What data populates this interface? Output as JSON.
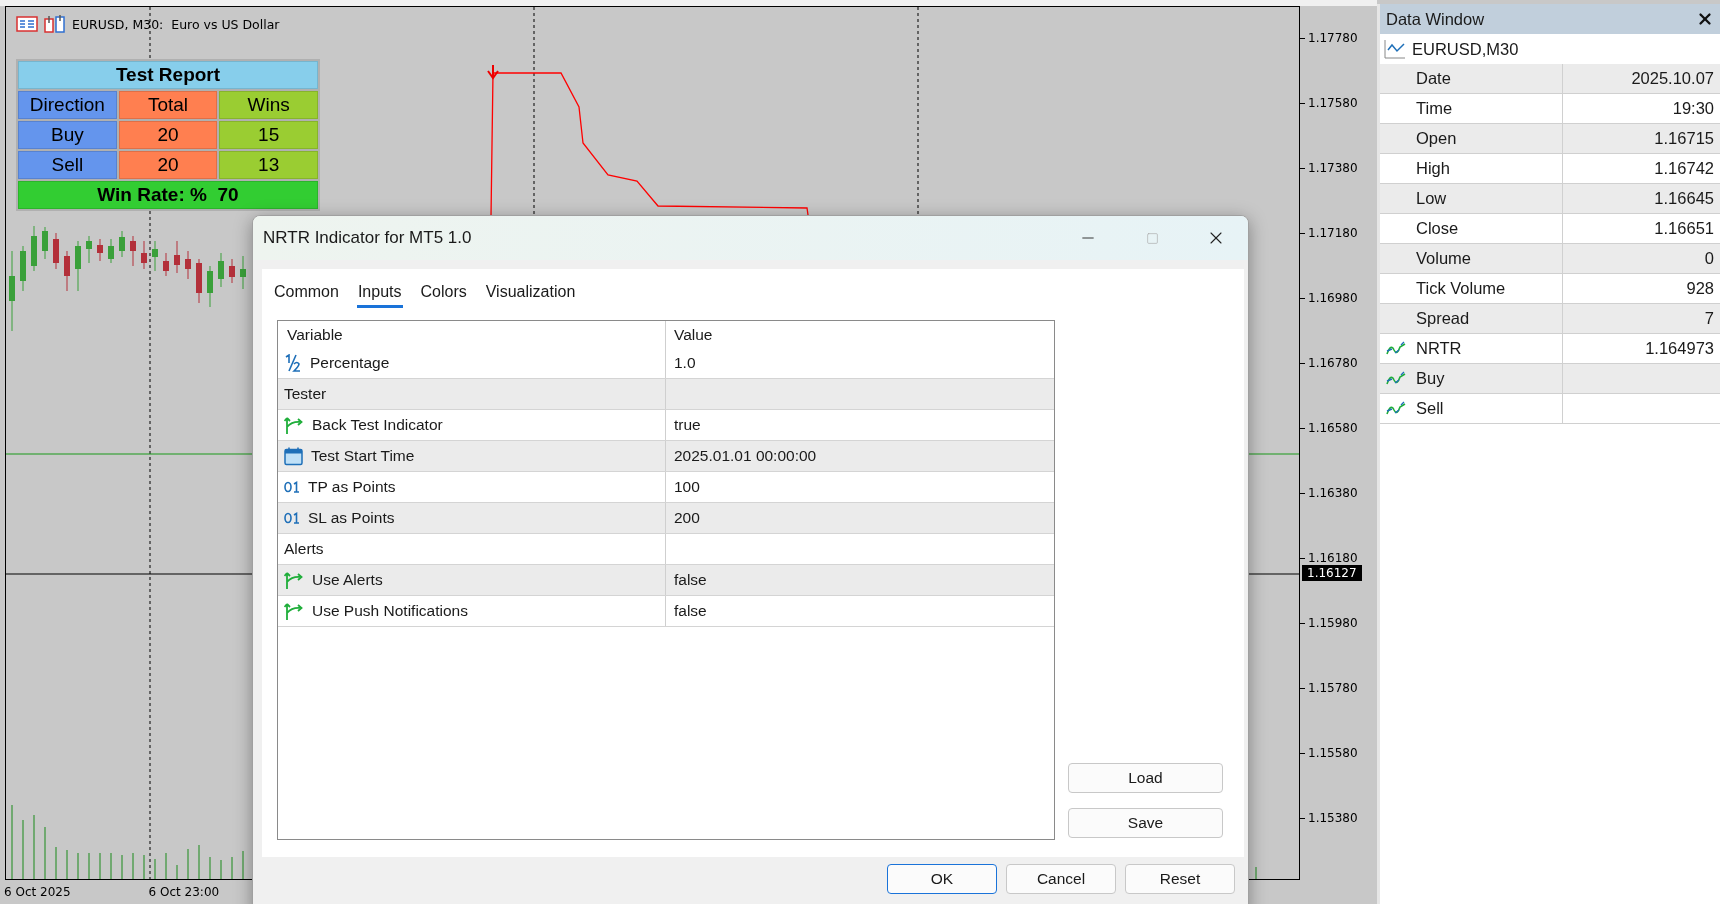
{
  "chart": {
    "title": "EURUSD, M30:  Euro vs US Dollar",
    "report": {
      "title": "Test Report",
      "header": [
        "Direction",
        "Total",
        "Wins"
      ],
      "rows": [
        [
          "Buy",
          "20",
          "15"
        ],
        [
          "Sell",
          "20",
          "13"
        ]
      ],
      "footer": "Win Rate: %  70"
    },
    "price_axis": [
      "1.17780",
      "1.17580",
      "1.17380",
      "1.17180",
      "1.16980",
      "1.16780",
      "1.16580",
      "1.16380",
      "1.16180",
      "1.15980",
      "1.15780",
      "1.15580",
      "1.15380"
    ],
    "current_price": "1.16127",
    "time_axis": [
      "6 Oct 2025",
      "6 Oct 23:00"
    ]
  },
  "dialog": {
    "title": "NRTR Indicator for MT5 1.0",
    "tabs": [
      {
        "label": "Common",
        "selected": false
      },
      {
        "label": "Inputs",
        "selected": true
      },
      {
        "label": "Colors",
        "selected": false
      },
      {
        "label": "Visualization",
        "selected": false
      }
    ],
    "columns": [
      "Variable",
      "Value"
    ],
    "rows": [
      {
        "kind": "double",
        "variable": "Percentage",
        "value": "1.0"
      },
      {
        "kind": "group",
        "variable": "Tester"
      },
      {
        "kind": "bool",
        "variable": "Back Test Indicator",
        "value": "true"
      },
      {
        "kind": "datetime",
        "variable": "Test Start Time",
        "value": "2025.01.01 00:00:00"
      },
      {
        "kind": "int",
        "variable": "TP as Points",
        "value": "100"
      },
      {
        "kind": "int",
        "variable": "SL as Points",
        "value": "200"
      },
      {
        "kind": "group",
        "variable": "Alerts"
      },
      {
        "kind": "bool",
        "variable": "Use Alerts",
        "value": "false"
      },
      {
        "kind": "bool",
        "variable": "Use Push Notifications",
        "value": "false"
      }
    ],
    "side_buttons": [
      "Load",
      "Save"
    ],
    "buttons": [
      {
        "label": "OK",
        "default": true
      },
      {
        "label": "Cancel",
        "default": false
      },
      {
        "label": "Reset",
        "default": false
      }
    ]
  },
  "data_window": {
    "title": "Data Window",
    "symbol": "EURUSD,M30",
    "rows": [
      {
        "kind": "field",
        "label": "Date",
        "value": "2025.10.07"
      },
      {
        "kind": "field",
        "label": "Time",
        "value": "19:30"
      },
      {
        "kind": "field",
        "label": "Open",
        "value": "1.16715"
      },
      {
        "kind": "field",
        "label": "High",
        "value": "1.16742"
      },
      {
        "kind": "field",
        "label": "Low",
        "value": "1.16645"
      },
      {
        "kind": "field",
        "label": "Close",
        "value": "1.16651"
      },
      {
        "kind": "field",
        "label": "Volume",
        "value": "0"
      },
      {
        "kind": "field",
        "label": "Tick Volume",
        "value": "928"
      },
      {
        "kind": "field",
        "label": "Spread",
        "value": "7"
      },
      {
        "kind": "indicator",
        "label": "NRTR",
        "value": "1.164973"
      },
      {
        "kind": "indicator",
        "label": "Buy"
      },
      {
        "kind": "indicator",
        "label": "Sell"
      }
    ]
  }
}
